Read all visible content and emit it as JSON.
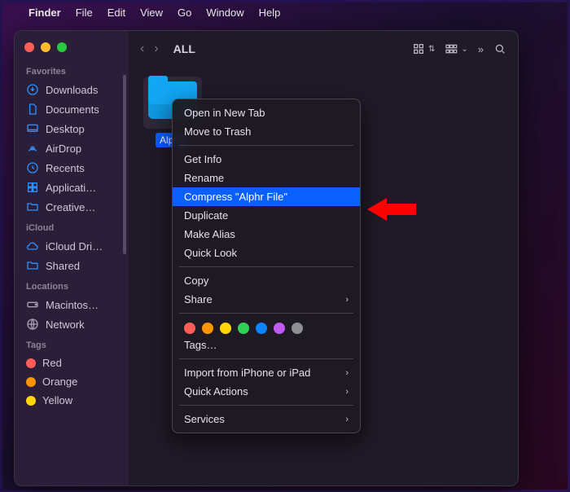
{
  "menubar": {
    "app_name": "Finder",
    "items": [
      "File",
      "Edit",
      "View",
      "Go",
      "Window",
      "Help"
    ]
  },
  "window": {
    "title": "ALL"
  },
  "sidebar": {
    "favorites_title": "Favorites",
    "favorites": [
      {
        "icon": "download",
        "label": "Downloads"
      },
      {
        "icon": "document",
        "label": "Documents"
      },
      {
        "icon": "desktop",
        "label": "Desktop"
      },
      {
        "icon": "airdrop",
        "label": "AirDrop"
      },
      {
        "icon": "clock",
        "label": "Recents"
      },
      {
        "icon": "grid",
        "label": "Applicati…"
      },
      {
        "icon": "folder",
        "label": "Creative…"
      }
    ],
    "icloud_title": "iCloud",
    "icloud": [
      {
        "icon": "cloud",
        "label": "iCloud Dri…"
      },
      {
        "icon": "folder",
        "label": "Shared"
      }
    ],
    "locations_title": "Locations",
    "locations": [
      {
        "icon": "disk",
        "label": "Macintos…"
      },
      {
        "icon": "globe",
        "label": "Network"
      }
    ],
    "tags_title": "Tags",
    "tags": [
      {
        "color": "#ff5e57",
        "label": "Red"
      },
      {
        "color": "#ff9500",
        "label": "Orange"
      },
      {
        "color": "#ffd60a",
        "label": "Yellow"
      }
    ]
  },
  "content": {
    "selected_folder_label": "Alphr"
  },
  "context_menu": {
    "open_new_tab": "Open in New Tab",
    "move_to_trash": "Move to Trash",
    "get_info": "Get Info",
    "rename": "Rename",
    "compress": "Compress \"Alphr File\"",
    "duplicate": "Duplicate",
    "make_alias": "Make Alias",
    "quick_look": "Quick Look",
    "copy": "Copy",
    "share": "Share",
    "tags_ellipsis": "Tags…",
    "import": "Import from iPhone or iPad",
    "quick_actions": "Quick Actions",
    "services": "Services",
    "tag_colors": [
      "#ff5e57",
      "#ff9500",
      "#ffd60a",
      "#30d158",
      "#0a84ff",
      "#bf5af2",
      "#8e8e93"
    ]
  }
}
